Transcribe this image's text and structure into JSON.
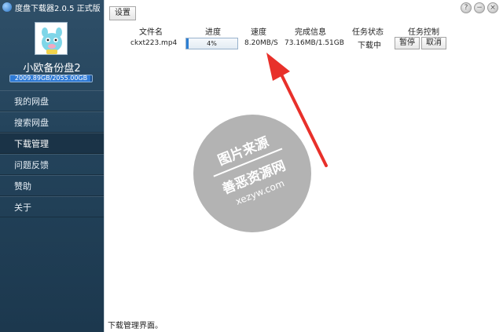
{
  "window": {
    "title": "度盘下载器2.0.5 正式版"
  },
  "sidebar": {
    "username": "小欧备份盘2",
    "quota": {
      "text": "2009.89GB/2055.00GB",
      "used_fraction": 0.978
    },
    "items": [
      {
        "label": "我的网盘",
        "active": false
      },
      {
        "label": "搜索网盘",
        "active": false
      },
      {
        "label": "下载管理",
        "active": true
      },
      {
        "label": "问题反馈",
        "active": false
      },
      {
        "label": "赞助",
        "active": false
      },
      {
        "label": "关于",
        "active": false
      }
    ]
  },
  "toolbar": {
    "settings_label": "设置"
  },
  "window_controls": {
    "help": "?",
    "minimize": "−",
    "close": "×"
  },
  "table": {
    "headers": [
      "文件名",
      "进度",
      "速度",
      "完成信息",
      "任务状态",
      "任务控制"
    ],
    "rows": [
      {
        "filename": "ckxt223.mp4",
        "progress_text": "4%",
        "progress_fraction": 0.04,
        "speed": "8.20MB/S",
        "done_info": "73.16MB/1.51GB",
        "state": "下载中",
        "pause_label": "暂停",
        "cancel_label": "取消"
      }
    ]
  },
  "statusbar": {
    "text": "下载管理界面。"
  },
  "watermark": {
    "line1": "图片来源",
    "line2": "善恶资源网",
    "line3": "xezyw.com"
  },
  "colors": {
    "sidebar": "#24445c",
    "accent": "#2d7fd3",
    "arrow": "#e8302a"
  },
  "icons": {
    "app": "app-logo-icon",
    "avatar": "cartoon-character-avatar"
  }
}
